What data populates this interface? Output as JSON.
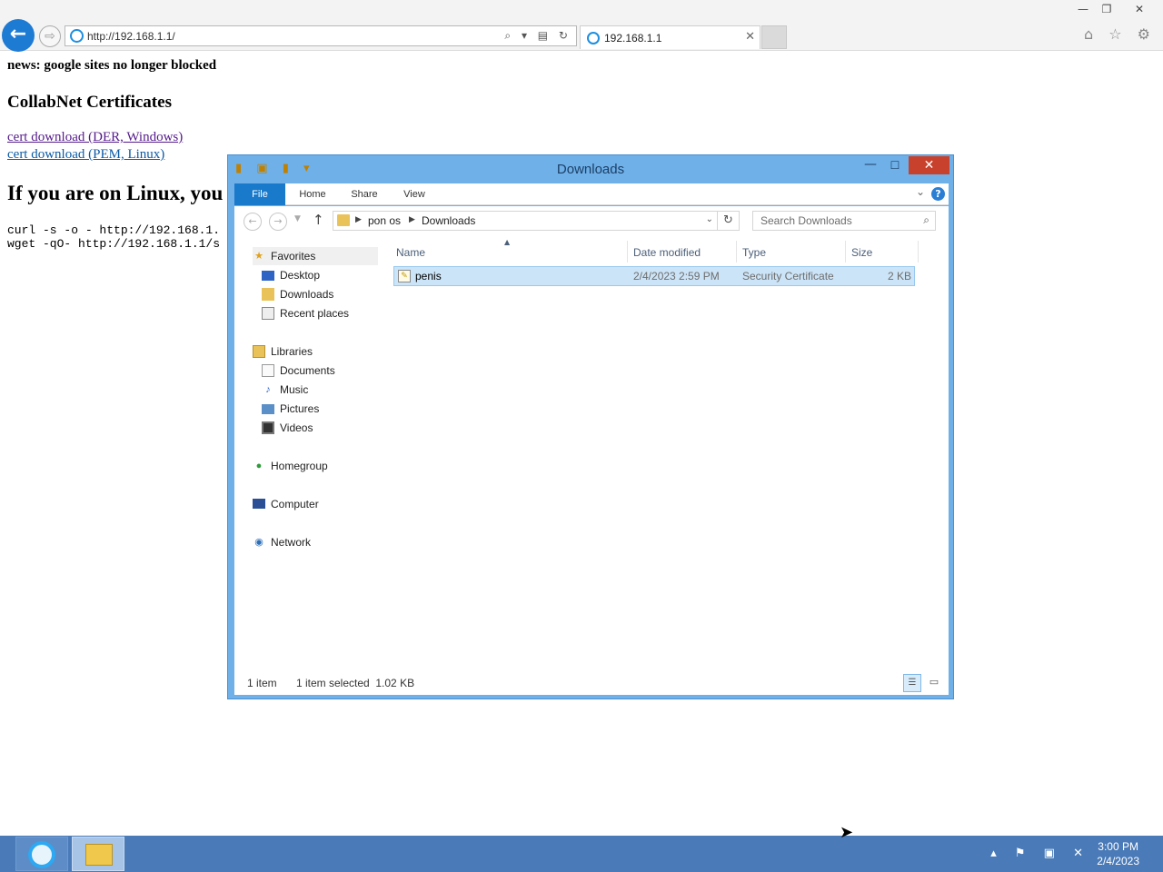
{
  "browser": {
    "url": "http://192.168.1.1/",
    "tab_title": "192.168.1.1",
    "address_icons": "⌕ ▾ ▤ ↻",
    "toolbar_icons": "⌂ ☆ ⚙"
  },
  "webpage": {
    "news": "news: google sites no longer blocked",
    "cert_heading": "CollabNet Certificates",
    "links": [
      {
        "label": "cert download (DER, Windows)",
        "color": "#551a8b"
      },
      {
        "label": "cert download (PEM, Linux)",
        "color": "#0b5aa6"
      }
    ],
    "linux_heading": "If you are on Linux, you",
    "commands": [
      "curl -s -o - http://192.168.1.",
      "wget -qO- http://192.168.1.1/s"
    ]
  },
  "explorer": {
    "title": "Downloads",
    "ribbon_tabs": [
      "File",
      "Home",
      "Share",
      "View"
    ],
    "breadcrumb": [
      "pon os",
      "Downloads"
    ],
    "search_placeholder": "Search Downloads",
    "nav_pane": {
      "favorites": [
        "Favorites",
        "Desktop",
        "Downloads",
        "Recent places"
      ],
      "libraries": [
        "Libraries",
        "Documents",
        "Music",
        "Pictures",
        "Videos"
      ],
      "homegroup": "Homegroup",
      "computer": "Computer",
      "network": "Network"
    },
    "columns": [
      "Name",
      "Date modified",
      "Type",
      "Size"
    ],
    "files": [
      {
        "name": "penis",
        "date_modified": "2/4/2023 2:59 PM",
        "type": "Security Certificate",
        "size": "2 KB",
        "selected": true
      }
    ],
    "status": {
      "item_count": "1 item",
      "selection": "1 item selected  1.02 KB"
    }
  },
  "taskbar": {
    "tray_icons": "▴ ⚑ ▣ ✕",
    "time": "3:00 PM",
    "date": "2/4/2023"
  },
  "colors": {
    "accent": "#1979ca",
    "window_frame": "#6fb0e8",
    "selection": "#cce4f7",
    "close_button": "#c7412d",
    "taskbar": "#4a7bb8"
  }
}
